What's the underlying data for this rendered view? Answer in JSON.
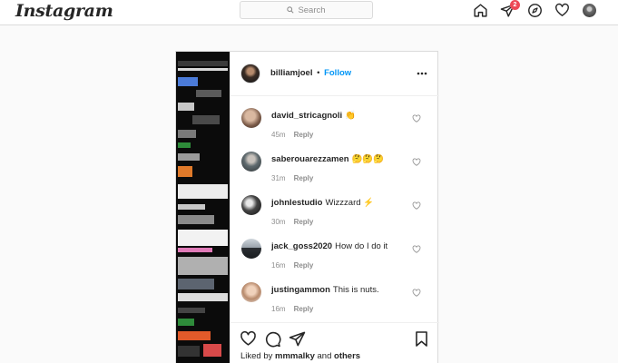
{
  "app": {
    "logo": "Instagram"
  },
  "search": {
    "placeholder": "Search",
    "icon": "search-icon"
  },
  "nav": {
    "icons": [
      "home-icon",
      "direct-messages-icon",
      "explore-compass-icon",
      "activity-heart-icon",
      "profile-avatar"
    ],
    "messages_badge": "2",
    "badge_color": "#ed4956"
  },
  "post": {
    "username": "billiamjoel",
    "separator": "•",
    "follow_label": "Follow",
    "follow_color": "#0095f6",
    "comments": [
      {
        "user": "david_stricagnoli",
        "text": "👏",
        "time": "45m",
        "reply": "Reply"
      },
      {
        "user": "saberouarezzamen",
        "text": "🤔🤔🤔",
        "time": "31m",
        "reply": "Reply"
      },
      {
        "user": "johnlestudio",
        "text": "Wizzzard ⚡",
        "time": "30m",
        "reply": "Reply"
      },
      {
        "user": "jack_goss2020",
        "text": "How do I do it",
        "time": "16m",
        "reply": "Reply"
      },
      {
        "user": "justingammon",
        "text": "This is nuts.",
        "time": "16m",
        "reply": "Reply"
      }
    ],
    "likes": {
      "prefix": "Liked by",
      "user": "mmmalky",
      "conj": "and",
      "others": "others"
    }
  }
}
